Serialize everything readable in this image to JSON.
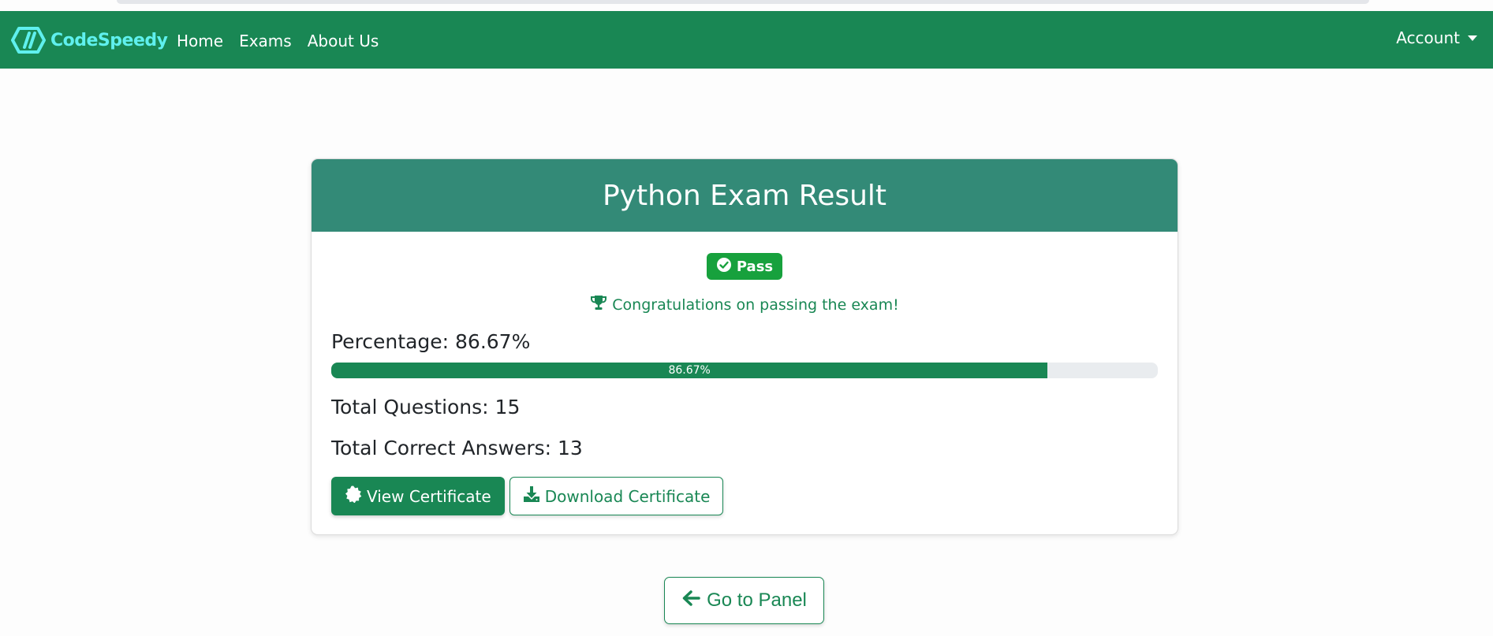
{
  "brand": {
    "name": "CodeSpeedy",
    "logo_icon": "codespeedy-logo-icon",
    "color": "#5ff0ee"
  },
  "nav": {
    "links": [
      {
        "label": "Home"
      },
      {
        "label": "Exams"
      },
      {
        "label": "About Us"
      }
    ],
    "account_label": "Account",
    "background": "#198754"
  },
  "result": {
    "title": "Python Exam Result",
    "status_badge": {
      "label": "Pass",
      "icon": "check-circle-icon",
      "color": "#17a13d"
    },
    "message": {
      "icon": "trophy-icon",
      "text": "Congratulations on passing the exam!"
    },
    "percentage_label": "Percentage: 86.67%",
    "progress": {
      "value_percent": 86.67,
      "label": "86.67%"
    },
    "total_questions_label": "Total Questions: 15",
    "total_correct_label": "Total Correct Answers: 13",
    "buttons": {
      "view": {
        "label": "View Certificate",
        "icon": "certificate-icon"
      },
      "download": {
        "label": "Download Certificate",
        "icon": "download-icon"
      }
    },
    "header_color": "#338a77"
  },
  "panel_button": {
    "label": "Go to Panel",
    "icon": "arrow-left-icon"
  },
  "accent_color": "#198754"
}
